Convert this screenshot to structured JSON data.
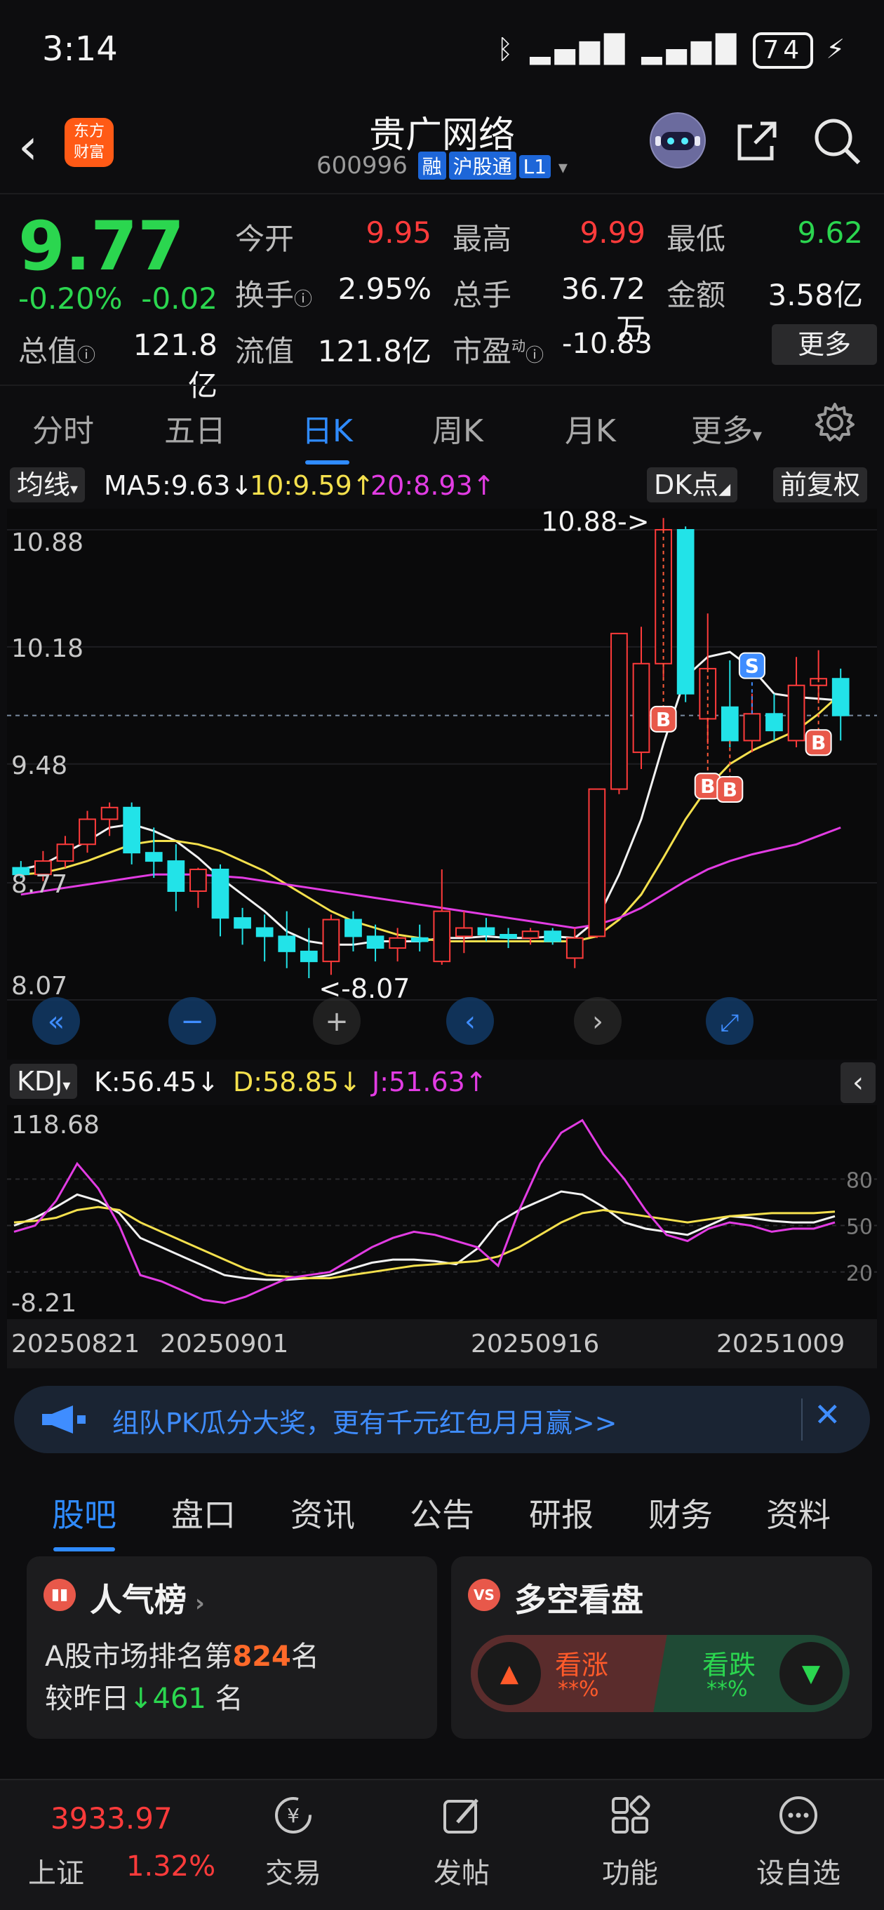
{
  "status_bar": {
    "time": "3:14",
    "battery": "74"
  },
  "header": {
    "stock_name": "贵广网络",
    "stock_code": "600996",
    "tags": [
      "融",
      "沪股通",
      "L1"
    ]
  },
  "quote": {
    "price": "9.77",
    "change_pct": "-0.20%",
    "change_abs": "-0.02",
    "fields": [
      {
        "label": "今开",
        "value": "9.95",
        "color": "#ff3b3b"
      },
      {
        "label": "最高",
        "value": "9.99",
        "color": "#ff3b3b"
      },
      {
        "label": "最低",
        "value": "9.62",
        "color": "#2bd64f"
      },
      {
        "label": "换手",
        "value": "2.95%",
        "color": "#f2f2f2"
      },
      {
        "label": "总手",
        "value": "36.72万",
        "color": "#f2f2f2"
      },
      {
        "label": "金额",
        "value": "3.58亿",
        "color": "#f2f2f2"
      }
    ],
    "total_value_label": "总值",
    "total_value": "121.8亿",
    "float_label": "流值",
    "float_value": "121.8亿",
    "pe_label": "市盈",
    "pe_sup": "动",
    "pe_value": "-10.83",
    "more_label": "更多"
  },
  "period_tabs": [
    {
      "label": "分时",
      "active": false
    },
    {
      "label": "五日",
      "active": false
    },
    {
      "label": "日K",
      "active": true
    },
    {
      "label": "周K",
      "active": false
    },
    {
      "label": "月K",
      "active": false
    },
    {
      "label": "更多",
      "active": false
    }
  ],
  "ma_bar": {
    "selector": "均线",
    "ma5": "MA5:9.63",
    "ma10": "10:9.59",
    "ma20": "20:8.93",
    "dk_label": "DK点",
    "adjust_label": "前复权",
    "colors": {
      "ma5": "#f2f2f2",
      "ma10": "#f4e04d",
      "ma20": "#e23ce3"
    }
  },
  "kdj_bar": {
    "selector": "KDJ",
    "k": "K:56.45",
    "d": "D:58.85",
    "j": "J:51.63"
  },
  "chart_data": [
    {
      "type": "candlestick",
      "ylim": [
        8.07,
        10.88
      ],
      "y_ticks": [
        "10.88",
        "10.18",
        "9.48",
        "8.77",
        "8.07"
      ],
      "max_marker": "10.88->",
      "min_marker": "<-8.07",
      "candles": [
        {
          "o": 8.86,
          "h": 8.9,
          "l": 8.8,
          "c": 8.82
        },
        {
          "o": 8.82,
          "h": 8.96,
          "l": 8.78,
          "c": 8.9
        },
        {
          "o": 8.9,
          "h": 9.05,
          "l": 8.86,
          "c": 9.0
        },
        {
          "o": 9.0,
          "h": 9.2,
          "l": 8.95,
          "c": 9.15
        },
        {
          "o": 9.15,
          "h": 9.25,
          "l": 9.05,
          "c": 9.22
        },
        {
          "o": 9.22,
          "h": 9.25,
          "l": 8.88,
          "c": 8.95
        },
        {
          "o": 8.95,
          "h": 9.1,
          "l": 8.8,
          "c": 8.9
        },
        {
          "o": 8.9,
          "h": 9.0,
          "l": 8.6,
          "c": 8.72
        },
        {
          "o": 8.72,
          "h": 8.86,
          "l": 8.62,
          "c": 8.85
        },
        {
          "o": 8.85,
          "h": 8.88,
          "l": 8.45,
          "c": 8.56
        },
        {
          "o": 8.56,
          "h": 8.62,
          "l": 8.4,
          "c": 8.5
        },
        {
          "o": 8.5,
          "h": 8.58,
          "l": 8.3,
          "c": 8.45
        },
        {
          "o": 8.45,
          "h": 8.6,
          "l": 8.26,
          "c": 8.36
        },
        {
          "o": 8.36,
          "h": 8.5,
          "l": 8.2,
          "c": 8.3
        },
        {
          "o": 8.3,
          "h": 8.58,
          "l": 8.22,
          "c": 8.55
        },
        {
          "o": 8.55,
          "h": 8.6,
          "l": 8.36,
          "c": 8.45
        },
        {
          "o": 8.45,
          "h": 8.52,
          "l": 8.3,
          "c": 8.38
        },
        {
          "o": 8.38,
          "h": 8.5,
          "l": 8.3,
          "c": 8.44
        },
        {
          "o": 8.44,
          "h": 8.52,
          "l": 8.36,
          "c": 8.42
        },
        {
          "o": 8.3,
          "h": 8.85,
          "l": 8.28,
          "c": 8.6
        },
        {
          "o": 8.45,
          "h": 8.6,
          "l": 8.35,
          "c": 8.5
        },
        {
          "o": 8.5,
          "h": 8.56,
          "l": 8.42,
          "c": 8.46
        },
        {
          "o": 8.46,
          "h": 8.5,
          "l": 8.38,
          "c": 8.44
        },
        {
          "o": 8.44,
          "h": 8.5,
          "l": 8.4,
          "c": 8.48
        },
        {
          "o": 8.48,
          "h": 8.5,
          "l": 8.4,
          "c": 8.42
        },
        {
          "o": 8.32,
          "h": 8.5,
          "l": 8.26,
          "c": 8.44
        },
        {
          "o": 8.45,
          "h": 9.33,
          "l": 8.44,
          "c": 9.33
        },
        {
          "o": 9.33,
          "h": 10.26,
          "l": 9.3,
          "c": 10.26
        },
        {
          "o": 9.55,
          "h": 10.3,
          "l": 9.45,
          "c": 10.08
        },
        {
          "o": 10.08,
          "h": 10.95,
          "l": 10.0,
          "c": 10.88
        },
        {
          "o": 10.88,
          "h": 10.9,
          "l": 9.85,
          "c": 9.9
        },
        {
          "o": 9.75,
          "h": 10.38,
          "l": 9.6,
          "c": 10.05
        },
        {
          "o": 9.82,
          "h": 10.1,
          "l": 9.58,
          "c": 9.62
        },
        {
          "o": 9.62,
          "h": 9.9,
          "l": 9.55,
          "c": 9.78
        },
        {
          "o": 9.78,
          "h": 9.9,
          "l": 9.62,
          "c": 9.68
        },
        {
          "o": 9.62,
          "h": 10.12,
          "l": 9.58,
          "c": 9.95
        },
        {
          "o": 9.95,
          "h": 10.16,
          "l": 9.86,
          "c": 9.99
        },
        {
          "o": 9.99,
          "h": 10.05,
          "l": 9.62,
          "c": 9.77
        }
      ],
      "ma5": [
        8.85,
        8.88,
        8.95,
        9.02,
        9.1,
        9.12,
        9.08,
        9.02,
        8.92,
        8.8,
        8.7,
        8.6,
        8.48,
        8.42,
        8.4,
        8.4,
        8.42,
        8.42,
        8.42,
        8.44,
        8.44,
        8.45,
        8.44,
        8.44,
        8.45,
        8.44,
        8.55,
        8.82,
        9.15,
        9.6,
        10.0,
        10.12,
        10.15,
        10.05,
        9.9,
        9.88,
        9.87,
        9.86
      ],
      "ma10": [
        8.82,
        8.83,
        8.86,
        8.9,
        8.95,
        9.0,
        9.02,
        9.02,
        9.0,
        8.96,
        8.9,
        8.84,
        8.76,
        8.68,
        8.6,
        8.54,
        8.5,
        8.46,
        8.44,
        8.42,
        8.42,
        8.42,
        8.42,
        8.42,
        8.42,
        8.42,
        8.45,
        8.55,
        8.7,
        8.92,
        9.15,
        9.34,
        9.48,
        9.56,
        9.62,
        9.68,
        9.78,
        9.9
      ],
      "ma20": [
        8.7,
        8.72,
        8.74,
        8.76,
        8.78,
        8.8,
        8.82,
        8.82,
        8.82,
        8.81,
        8.8,
        8.78,
        8.76,
        8.74,
        8.72,
        8.7,
        8.68,
        8.66,
        8.64,
        8.62,
        8.6,
        8.58,
        8.56,
        8.54,
        8.52,
        8.5,
        8.52,
        8.56,
        8.62,
        8.7,
        8.78,
        8.85,
        8.9,
        8.94,
        8.97,
        9.0,
        9.05,
        9.1
      ],
      "markers": [
        {
          "index": 29,
          "label": "B"
        },
        {
          "index": 31,
          "label": "B"
        },
        {
          "index": 32,
          "label": "B"
        },
        {
          "index": 33,
          "label": "S"
        },
        {
          "index": 36,
          "label": "B"
        }
      ]
    },
    {
      "type": "line",
      "title": "KDJ",
      "ylim": [
        -8.21,
        118.68
      ],
      "y_ticks": [
        "118.68",
        "-8.21"
      ],
      "right_ticks": [
        "80",
        "50",
        "20"
      ],
      "x_labels": [
        "20250821",
        "20250901",
        "20250916",
        "20251009"
      ],
      "series": [
        {
          "name": "K",
          "color": "#f2f2f2",
          "values": [
            50,
            55,
            62,
            70,
            66,
            58,
            42,
            36,
            30,
            24,
            18,
            16,
            15,
            15,
            16,
            18,
            22,
            26,
            28,
            28,
            27,
            25,
            35,
            52,
            60,
            66,
            72,
            70,
            62,
            52,
            48,
            46,
            44,
            50,
            56,
            55,
            53,
            52,
            52,
            56
          ]
        },
        {
          "name": "D",
          "color": "#f4e04d",
          "values": [
            52,
            53,
            55,
            60,
            62,
            60,
            52,
            46,
            40,
            34,
            28,
            22,
            18,
            17,
            16,
            16,
            18,
            20,
            22,
            24,
            25,
            26,
            27,
            30,
            36,
            44,
            52,
            58,
            60,
            58,
            56,
            54,
            52,
            54,
            56,
            57,
            58,
            58,
            58,
            59
          ]
        },
        {
          "name": "J",
          "color": "#e23ce3",
          "values": [
            46,
            50,
            66,
            90,
            74,
            50,
            18,
            14,
            8,
            2,
            0,
            4,
            10,
            16,
            18,
            20,
            28,
            36,
            42,
            46,
            44,
            40,
            36,
            24,
            60,
            90,
            110,
            118,
            96,
            80,
            60,
            44,
            40,
            48,
            52,
            50,
            46,
            48,
            48,
            52
          ]
        }
      ]
    }
  ],
  "promo": {
    "text": "组队PK瓜分大奖，更有千元红包月月赢>>"
  },
  "news_tabs": [
    {
      "label": "股吧",
      "active": true
    },
    {
      "label": "盘口",
      "active": false
    },
    {
      "label": "资讯",
      "active": false
    },
    {
      "label": "公告",
      "active": false
    },
    {
      "label": "研报",
      "active": false
    },
    {
      "label": "财务",
      "active": false
    },
    {
      "label": "资料",
      "active": false
    }
  ],
  "popularity_card": {
    "title": "人气榜",
    "line1_prefix": "A股市场排名第",
    "rank": "824",
    "line1_suffix": "名",
    "line2_prefix": "较昨日",
    "delta": "461",
    "line2_suffix": "名"
  },
  "sentiment_card": {
    "title": "多空看盘",
    "bull_label": "看涨",
    "bull_value": "**%",
    "bear_label": "看跌",
    "bear_value": "**%"
  },
  "bottom_nav": {
    "index_value": "3933.97",
    "index_name": "上证",
    "index_change": "1.32%",
    "items": [
      "交易",
      "发帖",
      "功能",
      "设自选"
    ]
  }
}
